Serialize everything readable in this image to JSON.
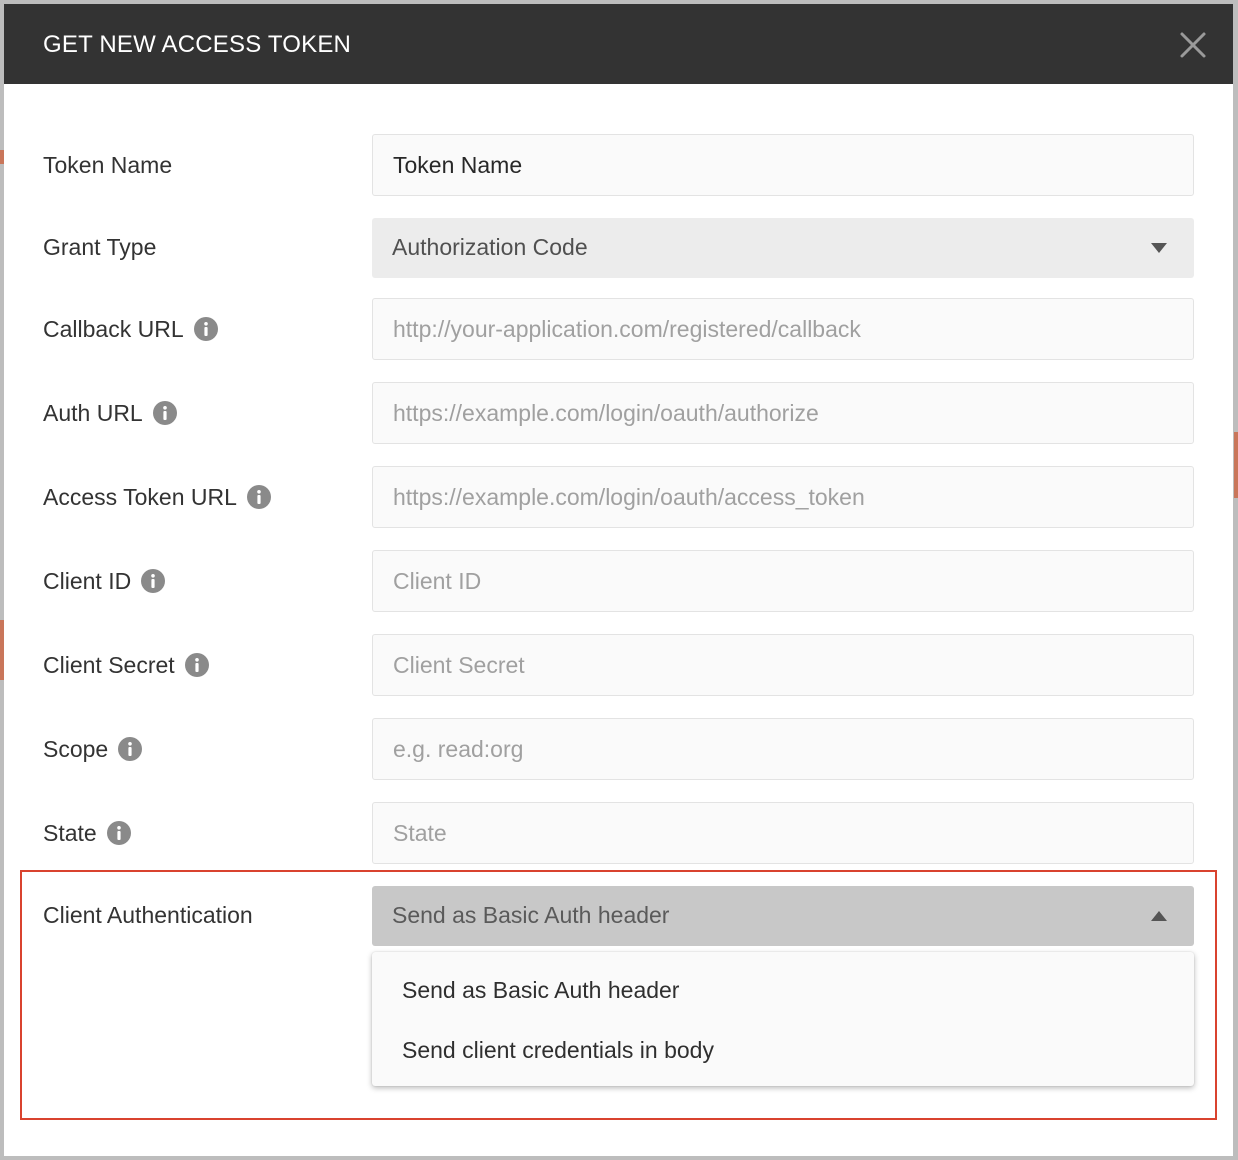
{
  "dialog": {
    "title": "GET NEW ACCESS TOKEN",
    "close_icon": "close-icon"
  },
  "fields": {
    "token_name": {
      "label": "Token Name",
      "value": "Token Name",
      "placeholder": ""
    },
    "grant_type": {
      "label": "Grant Type",
      "selected": "Authorization Code"
    },
    "callback_url": {
      "label": "Callback URL",
      "placeholder": "http://your-application.com/registered/callback",
      "value": ""
    },
    "auth_url": {
      "label": "Auth URL",
      "placeholder": "https://example.com/login/oauth/authorize",
      "value": ""
    },
    "access_token_url": {
      "label": "Access Token URL",
      "placeholder": "https://example.com/login/oauth/access_token",
      "value": ""
    },
    "client_id": {
      "label": "Client ID",
      "placeholder": "Client ID",
      "value": ""
    },
    "client_secret": {
      "label": "Client Secret",
      "placeholder": "Client Secret",
      "value": ""
    },
    "scope": {
      "label": "Scope",
      "placeholder": "e.g. read:org",
      "value": ""
    },
    "state": {
      "label": "State",
      "placeholder": "State",
      "value": ""
    },
    "client_authentication": {
      "label": "Client Authentication",
      "selected": "Send as Basic Auth header",
      "options": [
        "Send as Basic Auth header",
        "Send client credentials in body"
      ]
    }
  },
  "icons": {
    "info": "info-icon",
    "caret_down": "caret-down-icon",
    "caret_up": "caret-up-icon"
  },
  "colors": {
    "header_bg": "#333333",
    "highlight_border": "#d9432f",
    "input_bg": "#fafafa",
    "select_bg": "#ececec",
    "select_open_bg": "#c8c8c8"
  }
}
